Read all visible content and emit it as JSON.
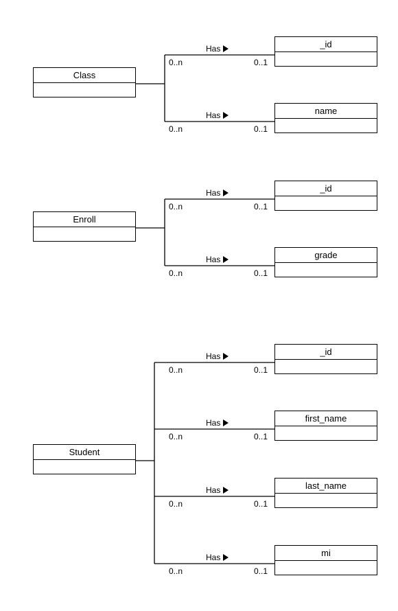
{
  "relation_label": "Has",
  "multiplicities": {
    "left": "0..n",
    "right": "0..1"
  },
  "entities": {
    "class": {
      "name": "Class",
      "attrs": [
        "_id",
        "name"
      ]
    },
    "enroll": {
      "name": "Enroll",
      "attrs": [
        "_id",
        "grade"
      ]
    },
    "student": {
      "name": "Student",
      "attrs": [
        "_id",
        "first_name",
        "last_name",
        "mi"
      ]
    }
  }
}
